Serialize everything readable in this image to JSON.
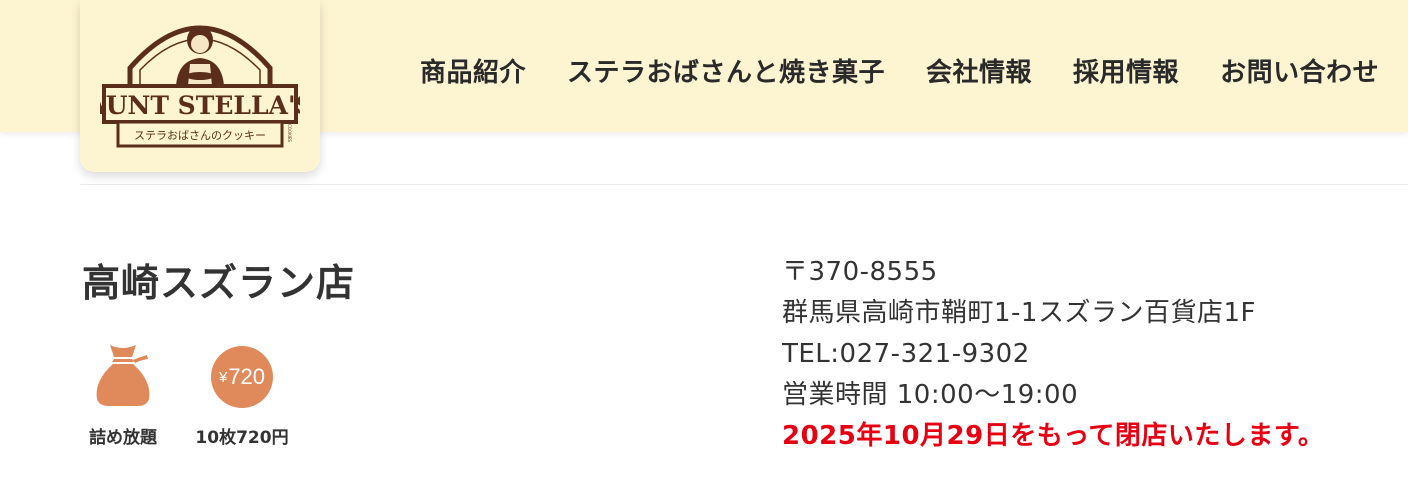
{
  "brand": {
    "logo_text": "AUNT STELLA'S",
    "logo_subtext": "ステラおばさんのクッキー",
    "logo_side": "COOKIES"
  },
  "nav": {
    "items": [
      {
        "label": "商品紹介"
      },
      {
        "label": "ステラおばさんと焼き菓子"
      },
      {
        "label": "会社情報"
      },
      {
        "label": "採用情報"
      },
      {
        "label": "お問い合わせ"
      }
    ]
  },
  "store": {
    "name": "高崎スズラン店",
    "features": [
      {
        "icon": "bag-icon",
        "label": "詰め放題"
      },
      {
        "icon": "price-badge-icon",
        "badge_yen": "¥",
        "badge_value": "720",
        "label": "10枚720円"
      }
    ],
    "postal": "〒370-8555",
    "address": "群馬県高崎市鞘町1-1スズラン百貨店1F",
    "tel": "TEL:027-321-9302",
    "hours": "営業時間 10:00〜19:00",
    "closing_notice": "2025年10月29日をもって閉店いたします。"
  },
  "colors": {
    "header_bg": "#fdf4d2",
    "accent_orange": "#e08a5c",
    "logo_brown": "#5a2e1a",
    "notice_red": "#e60012"
  }
}
